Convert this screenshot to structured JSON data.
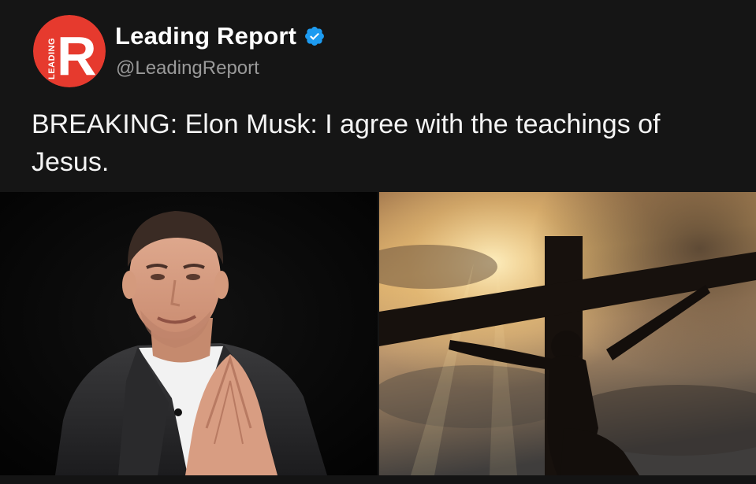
{
  "account": {
    "display_name": "Leading Report",
    "handle": "@LeadingReport",
    "verified": true,
    "avatar_letter": "R",
    "avatar_side_text": "LEADING",
    "avatar_color": "#e63a2e",
    "verified_color": "#1d9bf0"
  },
  "post": {
    "text": "BREAKING: Elon Musk: I agree with the teachings of Jesus."
  },
  "media": {
    "images": [
      {
        "name": "elon-musk-photo",
        "icon": "portrait-photo"
      },
      {
        "name": "crucifix-sky-photo",
        "icon": "crucifix-silhouette-photo"
      }
    ]
  },
  "colors": {
    "background": "#151515",
    "text": "#ffffff",
    "handle": "#9a9a9a"
  }
}
